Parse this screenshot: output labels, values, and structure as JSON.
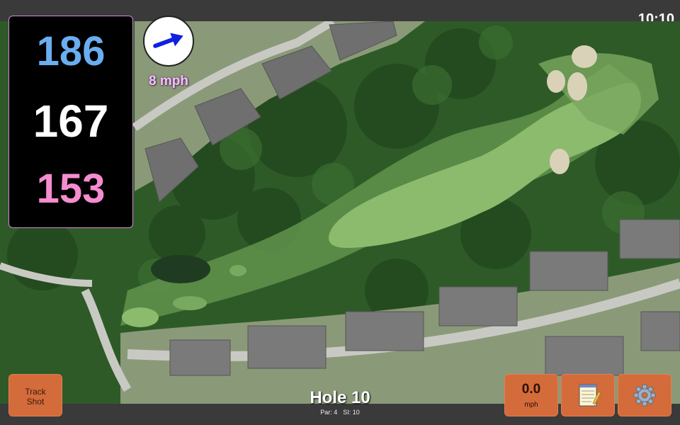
{
  "status": {
    "time": "10:10"
  },
  "yardages": {
    "back": "186",
    "middle": "167",
    "front": "153"
  },
  "wind": {
    "speed_label": "8 mph",
    "icon": "wind-arrow-icon",
    "arrow_color": "#1020e0"
  },
  "hole": {
    "title": "Hole 10",
    "par": "Par: 4",
    "stroke_index": "SI: 10"
  },
  "buttons": {
    "track_shot": "Track\nShot",
    "speed_value": "0.0",
    "speed_unit": "mph",
    "notes_icon": "notepad-icon",
    "settings_icon": "gear-icon"
  },
  "colors": {
    "button": "#d46b3b",
    "back_yardage": "#6aaef0",
    "middle_yardage": "#ffffff",
    "front_yardage": "#f58ccf",
    "panel_border": "#d58bd9"
  }
}
